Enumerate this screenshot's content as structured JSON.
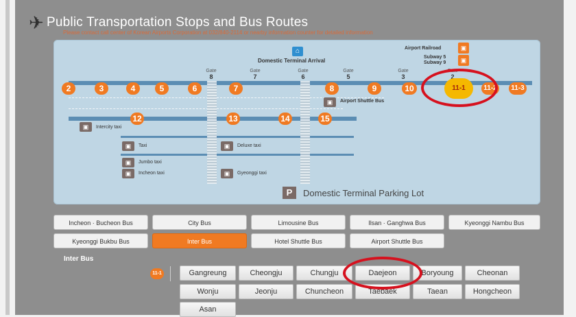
{
  "header": {
    "title": "Public Transportation Stops and Bus Routes",
    "subtitle": "Please contact call center of Korean Airports Corporation at 032/840-2114 or nearby information counter for detailed information",
    "plane_icon": "airplane-icon"
  },
  "map": {
    "info_icon": "info-icon",
    "domestic_arrival": "Domestic Terminal Arrival",
    "airport_railroad": "Airport Railroad",
    "subway_lines": [
      "Subway 5",
      "Subway 9"
    ],
    "gates": [
      {
        "label": "Gate",
        "num": "8"
      },
      {
        "label": "Gate",
        "num": "7"
      },
      {
        "label": "Gate",
        "num": "6"
      },
      {
        "label": "Gate",
        "num": "5"
      },
      {
        "label": "Gate",
        "num": "3"
      },
      {
        "label": "Gate",
        "num": "2"
      }
    ],
    "stops_row1": [
      "2",
      "3",
      "4",
      "5",
      "6",
      "7",
      "8",
      "9",
      "10",
      "11-1",
      "11-2",
      "11-3"
    ],
    "stops_row2": [
      "12",
      "13",
      "14",
      "15"
    ],
    "shuttle_label": "Airport Shuttle Bus",
    "taxi_labels": {
      "intercity": "Intercity taxi",
      "taxi": "Taxi",
      "deluxe": "Deluxe taxi",
      "jumbo": "Jumbo taxi",
      "incheon": "Incheon taxi",
      "gyeonggi": "Gyeonggi taxi"
    },
    "parking_letter": "P",
    "parking_label": "Domestic Terminal  Parking Lot"
  },
  "bus_types_row1": [
    "Incheon · Bucheon Bus",
    "City Bus",
    "Limousine Bus",
    "Ilsan · Ganghwa Bus",
    "Kyeonggі Nambu Bus"
  ],
  "bus_types_row2": [
    "Kyeonggi Bukbu Bus",
    "Inter Bus",
    "Hotel Shuttle Bus",
    "Airport Shuttle Bus"
  ],
  "selected": {
    "label": "Inter Bus",
    "stop_badge": "11-1",
    "destinations_row1": [
      "Gangreung",
      "Cheongju",
      "Chungju",
      "Daejeon",
      "Boryoung",
      "Cheonan"
    ],
    "destinations_row2": [
      "Wonju",
      "Jeonju",
      "Chuncheon",
      "Taebaek",
      "Taean",
      "Hongcheon"
    ],
    "destinations_row3": [
      "Asan"
    ]
  },
  "colors": {
    "accent": "#f07a22",
    "highlight": "#d6111e",
    "panel": "#8e8e8e",
    "map": "#bfd6e4"
  }
}
